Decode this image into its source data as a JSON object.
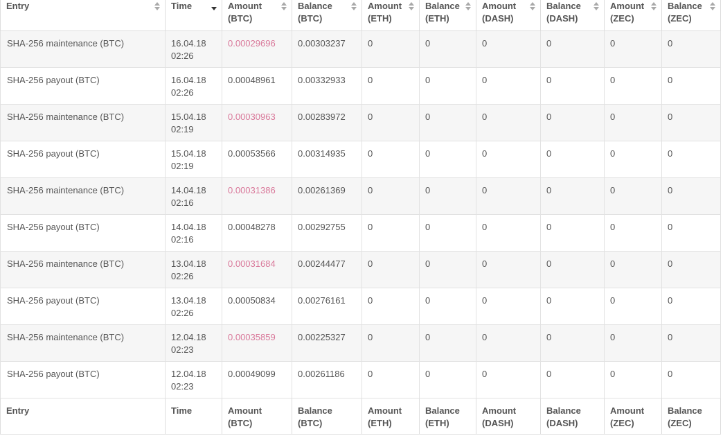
{
  "colors": {
    "negative_amount": "#d9789a",
    "row_stripe": "#f6f6f6",
    "text": "#555555",
    "border": "#dddddd"
  },
  "table": {
    "headers": [
      {
        "line1": "Entry",
        "line2": "",
        "sort": "both"
      },
      {
        "line1": "Time",
        "line2": "",
        "sort": "desc"
      },
      {
        "line1": "Amount",
        "line2": "(BTC)",
        "sort": "both"
      },
      {
        "line1": "Balance",
        "line2": "(BTC)",
        "sort": "both"
      },
      {
        "line1": "Amount",
        "line2": "(ETH)",
        "sort": "both"
      },
      {
        "line1": "Balance",
        "line2": "(ETH)",
        "sort": "both"
      },
      {
        "line1": "Amount",
        "line2": "(DASH)",
        "sort": "both"
      },
      {
        "line1": "Balance",
        "line2": "(DASH)",
        "sort": "both"
      },
      {
        "line1": "Amount",
        "line2": "(ZEC)",
        "sort": "both"
      },
      {
        "line1": "Balance",
        "line2": "(ZEC)",
        "sort": "both"
      }
    ],
    "rows": [
      {
        "entry": "SHA-256 maintenance (BTC)",
        "date": "16.04.18",
        "time": "02:26",
        "amount_btc": "0.00029696",
        "amount_btc_negative": true,
        "balance_btc": "0.00303237",
        "amount_eth": "0",
        "balance_eth": "0",
        "amount_dash": "0",
        "balance_dash": "0",
        "amount_zec": "0",
        "balance_zec": "0"
      },
      {
        "entry": "SHA-256 payout (BTC)",
        "date": "16.04.18",
        "time": "02:26",
        "amount_btc": "0.00048961",
        "amount_btc_negative": false,
        "balance_btc": "0.00332933",
        "amount_eth": "0",
        "balance_eth": "0",
        "amount_dash": "0",
        "balance_dash": "0",
        "amount_zec": "0",
        "balance_zec": "0"
      },
      {
        "entry": "SHA-256 maintenance (BTC)",
        "date": "15.04.18",
        "time": "02:19",
        "amount_btc": "0.00030963",
        "amount_btc_negative": true,
        "balance_btc": "0.00283972",
        "amount_eth": "0",
        "balance_eth": "0",
        "amount_dash": "0",
        "balance_dash": "0",
        "amount_zec": "0",
        "balance_zec": "0"
      },
      {
        "entry": "SHA-256 payout (BTC)",
        "date": "15.04.18",
        "time": "02:19",
        "amount_btc": "0.00053566",
        "amount_btc_negative": false,
        "balance_btc": "0.00314935",
        "amount_eth": "0",
        "balance_eth": "0",
        "amount_dash": "0",
        "balance_dash": "0",
        "amount_zec": "0",
        "balance_zec": "0"
      },
      {
        "entry": "SHA-256 maintenance (BTC)",
        "date": "14.04.18",
        "time": "02:16",
        "amount_btc": "0.00031386",
        "amount_btc_negative": true,
        "balance_btc": "0.00261369",
        "amount_eth": "0",
        "balance_eth": "0",
        "amount_dash": "0",
        "balance_dash": "0",
        "amount_zec": "0",
        "balance_zec": "0"
      },
      {
        "entry": "SHA-256 payout (BTC)",
        "date": "14.04.18",
        "time": "02:16",
        "amount_btc": "0.00048278",
        "amount_btc_negative": false,
        "balance_btc": "0.00292755",
        "amount_eth": "0",
        "balance_eth": "0",
        "amount_dash": "0",
        "balance_dash": "0",
        "amount_zec": "0",
        "balance_zec": "0"
      },
      {
        "entry": "SHA-256 maintenance (BTC)",
        "date": "13.04.18",
        "time": "02:26",
        "amount_btc": "0.00031684",
        "amount_btc_negative": true,
        "balance_btc": "0.00244477",
        "amount_eth": "0",
        "balance_eth": "0",
        "amount_dash": "0",
        "balance_dash": "0",
        "amount_zec": "0",
        "balance_zec": "0"
      },
      {
        "entry": "SHA-256 payout (BTC)",
        "date": "13.04.18",
        "time": "02:26",
        "amount_btc": "0.00050834",
        "amount_btc_negative": false,
        "balance_btc": "0.00276161",
        "amount_eth": "0",
        "balance_eth": "0",
        "amount_dash": "0",
        "balance_dash": "0",
        "amount_zec": "0",
        "balance_zec": "0"
      },
      {
        "entry": "SHA-256 maintenance (BTC)",
        "date": "12.04.18",
        "time": "02:23",
        "amount_btc": "0.00035859",
        "amount_btc_negative": true,
        "balance_btc": "0.00225327",
        "amount_eth": "0",
        "balance_eth": "0",
        "amount_dash": "0",
        "balance_dash": "0",
        "amount_zec": "0",
        "balance_zec": "0"
      },
      {
        "entry": "SHA-256 payout (BTC)",
        "date": "12.04.18",
        "time": "02:23",
        "amount_btc": "0.00049099",
        "amount_btc_negative": false,
        "balance_btc": "0.00261186",
        "amount_eth": "0",
        "balance_eth": "0",
        "amount_dash": "0",
        "balance_dash": "0",
        "amount_zec": "0",
        "balance_zec": "0"
      }
    ],
    "footer": [
      {
        "line1": "Entry",
        "line2": ""
      },
      {
        "line1": "Time",
        "line2": ""
      },
      {
        "line1": "Amount",
        "line2": "(BTC)"
      },
      {
        "line1": "Balance",
        "line2": "(BTC)"
      },
      {
        "line1": "Amount",
        "line2": "(ETH)"
      },
      {
        "line1": "Balance",
        "line2": "(ETH)"
      },
      {
        "line1": "Amount",
        "line2": "(DASH)"
      },
      {
        "line1": "Balance",
        "line2": "(DASH)"
      },
      {
        "line1": "Amount",
        "line2": "(ZEC)"
      },
      {
        "line1": "Balance",
        "line2": "(ZEC)"
      }
    ]
  }
}
